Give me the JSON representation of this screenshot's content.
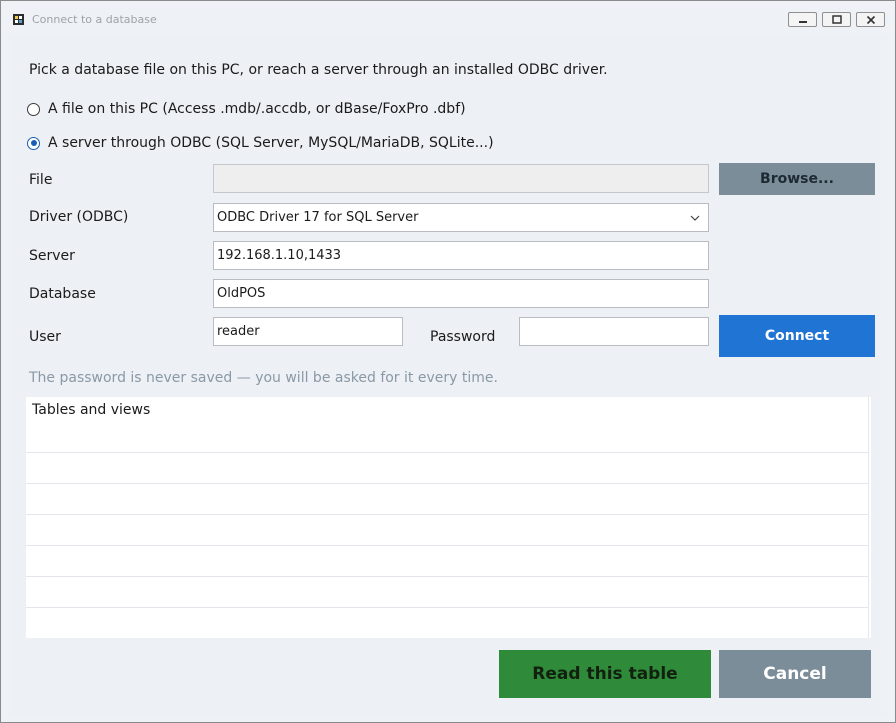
{
  "window": {
    "title": "Connect to a database"
  },
  "intro": "Pick a database file on this PC, or reach a server through an installed ODBC driver.",
  "source": {
    "options": [
      {
        "label": "A file on this PC (Access .mdb/.accdb, or dBase/FoxPro .dbf)",
        "checked": false
      },
      {
        "label": "A server through ODBC (SQL Server, MySQL/MariaDB, SQLite...)",
        "checked": true
      }
    ]
  },
  "form": {
    "file_label": "File",
    "file_value": "",
    "browse_label": "Browse...",
    "driver_label": "Driver (ODBC)",
    "driver_value": "ODBC Driver 17 for SQL Server",
    "server_label": "Server",
    "server_value": "192.168.1.10,1433",
    "database_label": "Database",
    "database_value": "OldPOS",
    "user_label": "User",
    "user_value": "reader",
    "password_label": "Password",
    "password_value": "",
    "connect_label": "Connect"
  },
  "hint": "The password is never saved — you will be asked for it every time.",
  "tables": {
    "header": "Tables and views",
    "rows": []
  },
  "footer": {
    "read_label": "Read this table",
    "cancel_label": "Cancel"
  },
  "colors": {
    "connect": "#1f74d4",
    "read": "#2f8a39",
    "neutral": "#7a8d99",
    "hint": "#8a99a6"
  }
}
